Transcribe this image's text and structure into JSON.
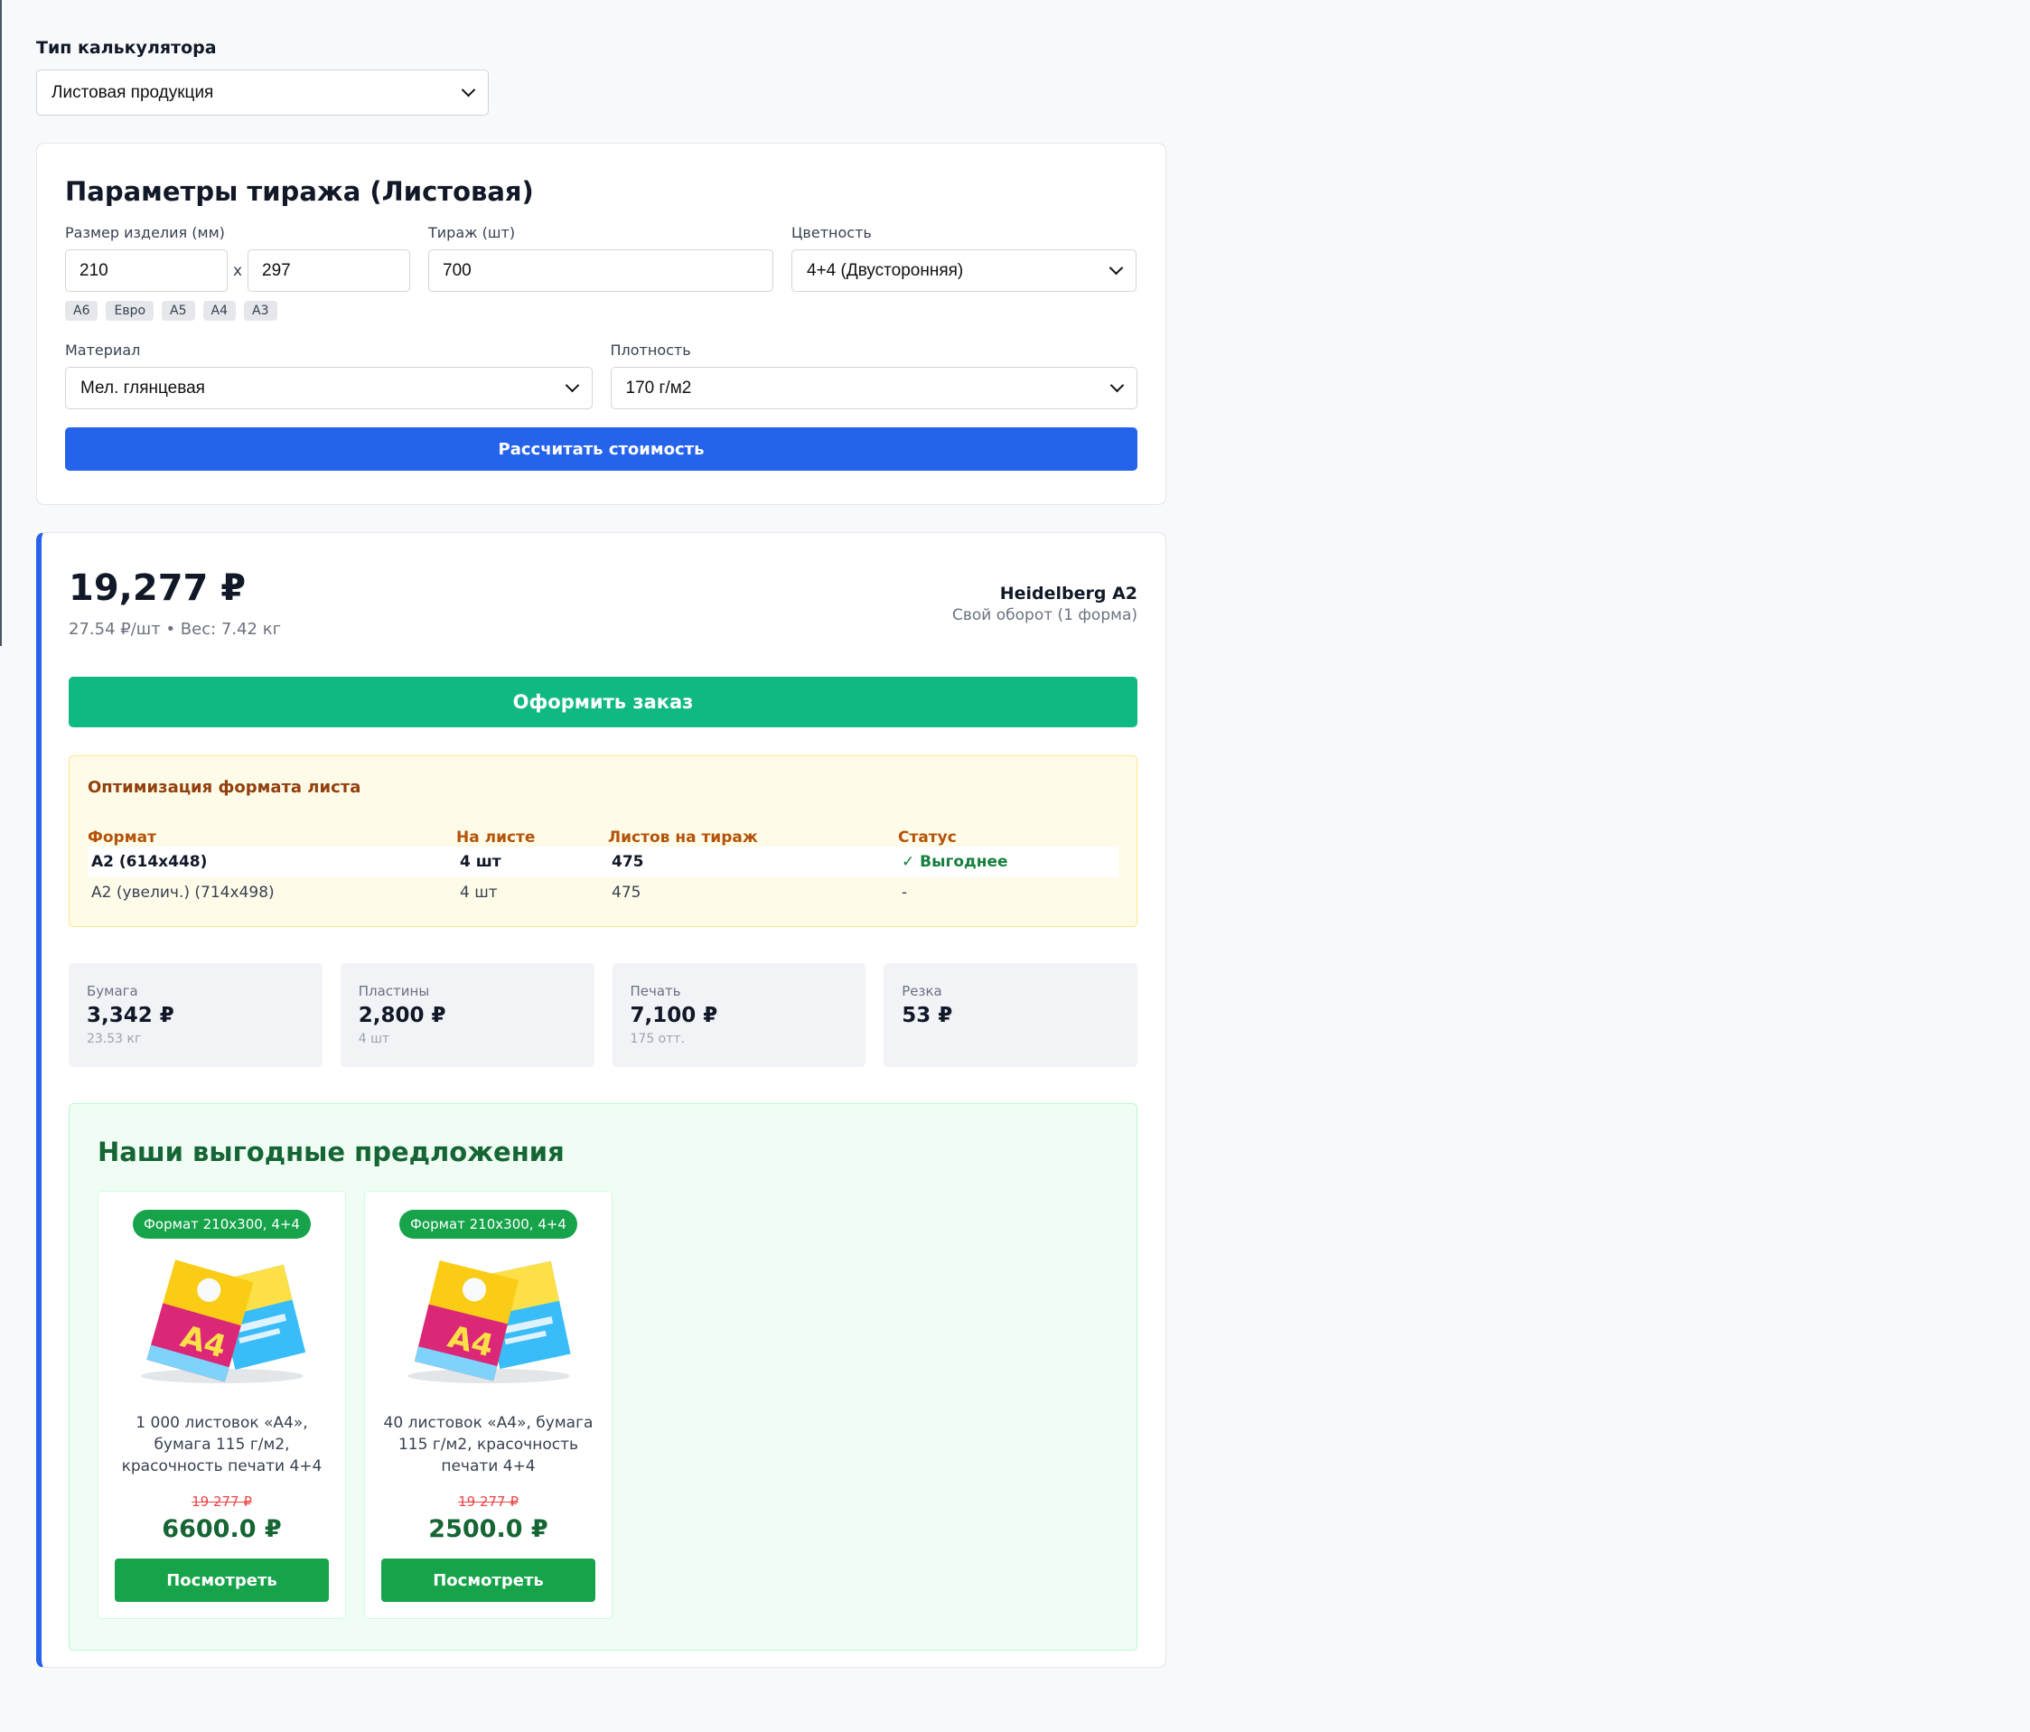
{
  "calc_type": {
    "label": "Тип калькулятора",
    "value": "Листовая продукция"
  },
  "params": {
    "title": "Параметры тиража (Листовая)",
    "size_label": "Размер изделия (мм)",
    "width": "210",
    "separator": "x",
    "height": "297",
    "presets": [
      "A6",
      "Евро",
      "A5",
      "A4",
      "A3"
    ],
    "run_label": "Тираж (шт)",
    "run_value": "700",
    "color_label": "Цветность",
    "color_value": "4+4 (Двусторонняя)",
    "material_label": "Материал",
    "material_value": "Мел. глянцевая",
    "density_label": "Плотность",
    "density_value": "170 г/м2",
    "calc_button": "Рассчитать стоимость"
  },
  "result": {
    "total": "19,277 ₽",
    "sub": "27.54 ₽/шт • Вес: 7.42 кг",
    "machine": "Heidelberg A2",
    "machine_sub": "Свой оборот (1 форма)",
    "order_button": "Оформить заказ",
    "optimization": {
      "title": "Оптимизация формата листа",
      "headers": [
        "Формат",
        "На листе",
        "Листов на тираж",
        "Статус"
      ],
      "rows": [
        {
          "format": "A2 (614x448)",
          "per_sheet": "4 шт",
          "sheets": "475",
          "status": "✓ Выгоднее"
        },
        {
          "format": "A2 (увелич.) (714x498)",
          "per_sheet": "4 шт",
          "sheets": "475",
          "status": "-"
        }
      ]
    },
    "costs": [
      {
        "label": "Бумага",
        "value": "3,342 ₽",
        "sub": "23.53 кг"
      },
      {
        "label": "Пластины",
        "value": "2,800 ₽",
        "sub": "4 шт"
      },
      {
        "label": "Печать",
        "value": "7,100 ₽",
        "sub": "175 отт."
      },
      {
        "label": "Резка",
        "value": "53 ₽",
        "sub": ""
      }
    ]
  },
  "offers": {
    "title": "Наши выгодные предложения",
    "items": [
      {
        "badge": "Формат 210x300, 4+4",
        "desc": "1 000 листовок «А4», бумага 115 г/м2, красочность печати 4+4",
        "old_price": "19 277 ₽",
        "new_price": "6600.0 ₽",
        "button": "Посмотреть"
      },
      {
        "badge": "Формат 210x300, 4+4",
        "desc": "40 листовок «А4», бумага 115 г/м2, красочность печати 4+4",
        "old_price": "19 277 ₽",
        "new_price": "2500.0 ₽",
        "button": "Посмотреть"
      }
    ]
  },
  "colors": {
    "primary": "#2563eb",
    "success": "#10b981",
    "offer_green": "#16a34a",
    "warning_bg": "#fefce8"
  }
}
